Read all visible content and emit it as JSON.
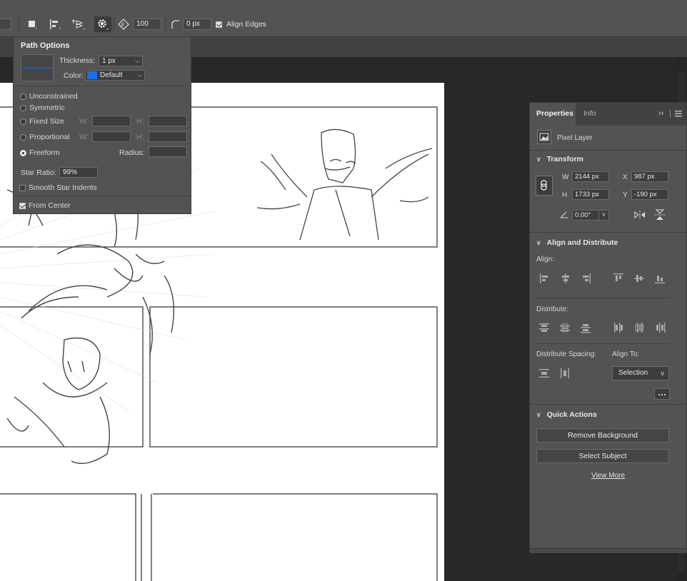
{
  "toolbar": {
    "stroke_width": "100",
    "radius_value": "0 px",
    "align_edges_label": "Align Edges",
    "align_edges_checked": true
  },
  "path_options": {
    "title": "Path Options",
    "thickness_label": "Thickness:",
    "thickness_value": "1 px",
    "color_label": "Color:",
    "color_value": "Default",
    "color_swatch": "#1e6fe6",
    "options": [
      {
        "label": "Unconstrained",
        "selected": false
      },
      {
        "label": "Symmetric",
        "selected": false
      },
      {
        "label": "Fixed Size",
        "selected": false
      },
      {
        "label": "Proportional",
        "selected": false
      },
      {
        "label": "Freeform",
        "selected": true
      }
    ],
    "w_label": "W:",
    "h_label": "H:",
    "radius_label": "Radius:",
    "star_ratio_label": "Star Ratio:",
    "star_ratio_value": "99%",
    "smooth_indents_label": "Smooth Star Indents",
    "from_center_label": "From Center"
  },
  "properties": {
    "tabs": [
      "Properties",
      "Info"
    ],
    "layer_type": "Pixel Layer",
    "transform": {
      "title": "Transform",
      "w_label": "W",
      "w_value": "2144 px",
      "h_label": "H",
      "h_value": "1733 px",
      "x_label": "X",
      "x_value": "987 px",
      "y_label": "Y",
      "y_value": "-190 px",
      "angle_value": "0.00°"
    },
    "align": {
      "title": "Align and Distribute",
      "align_label": "Align:",
      "distribute_label": "Distribute:",
      "spacing_label": "Distribute Spacing:",
      "align_to_label": "Align To:",
      "align_to_value": "Selection"
    },
    "quick_actions": {
      "title": "Quick Actions",
      "remove_bg": "Remove Background",
      "select_subject": "Select Subject",
      "view_more": "View More"
    }
  },
  "colors": {
    "app_bg": "#282828",
    "panel_bg": "#535353",
    "accent_blue": "#1e6fe6"
  }
}
